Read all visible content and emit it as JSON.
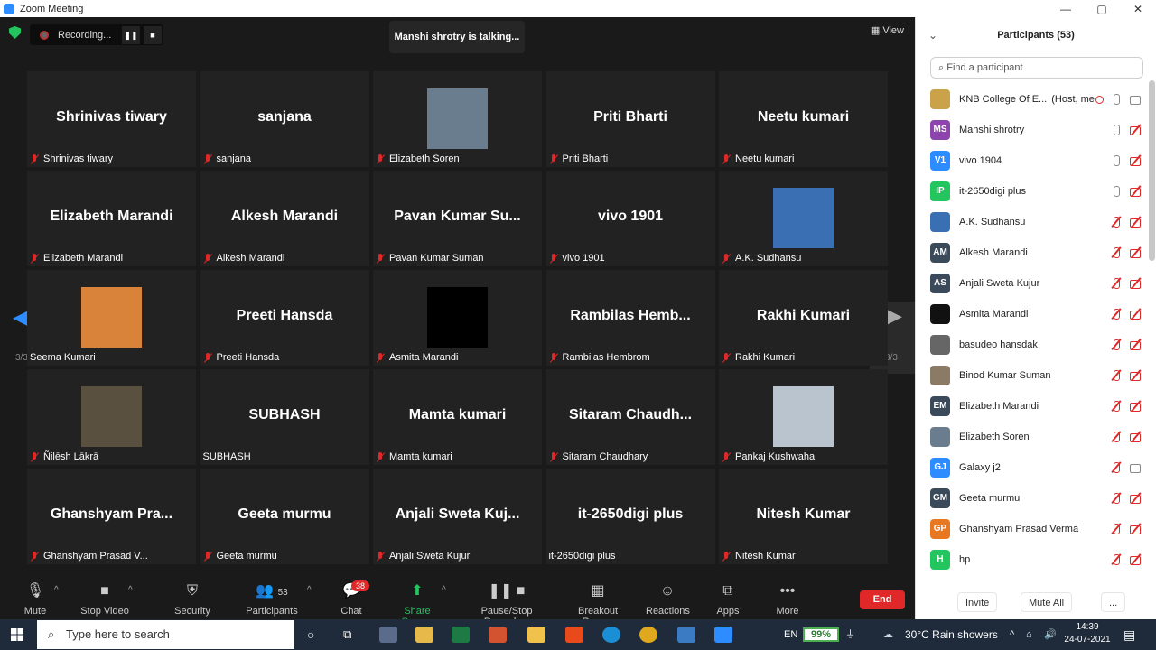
{
  "window": {
    "title": "Zoom Meeting",
    "controls": [
      "—",
      "▢",
      "✕"
    ]
  },
  "topbar": {
    "recording_label": "Recording...",
    "talking": "Manshi shrotry is talking...",
    "view_label": "View"
  },
  "pagination": {
    "left_page": "3/3",
    "right_page": "3/3"
  },
  "tiles": [
    {
      "big": "Shrinivas tiwary",
      "label": "Shrinivas tiwary",
      "muted": true,
      "photo": false
    },
    {
      "big": "sanjana",
      "label": "sanjana",
      "muted": true,
      "photo": false
    },
    {
      "big": "",
      "label": "Elizabeth Soren",
      "muted": true,
      "photo": true,
      "photo_color": "#6a7d8f"
    },
    {
      "big": "Priti Bharti",
      "label": "Priti Bharti",
      "muted": true,
      "photo": false
    },
    {
      "big": "Neetu kumari",
      "label": "Neetu kumari",
      "muted": true,
      "photo": false
    },
    {
      "big": "Elizabeth Marandi",
      "label": "Elizabeth Marandi",
      "muted": true,
      "photo": false
    },
    {
      "big": "Alkesh Marandi",
      "label": "Alkesh Marandi",
      "muted": true,
      "photo": false
    },
    {
      "big": "Pavan Kumar Su...",
      "label": "Pavan Kumar Suman",
      "muted": true,
      "photo": false
    },
    {
      "big": "vivo 1901",
      "label": "vivo 1901",
      "muted": true,
      "photo": false
    },
    {
      "big": "",
      "label": "A.K. Sudhansu",
      "muted": true,
      "photo": true,
      "photo_color": "#3a6fb3"
    },
    {
      "big": "",
      "label": "Seema Kumari",
      "muted": false,
      "photo": true,
      "photo_color": "#d8823a"
    },
    {
      "big": "Preeti Hansda",
      "label": "Preeti Hansda",
      "muted": true,
      "photo": false
    },
    {
      "big": "",
      "label": "Asmita Marandi",
      "muted": true,
      "photo": true,
      "photo_color": "#000000"
    },
    {
      "big": "Rambilas Hemb...",
      "label": "Rambilas Hembrom",
      "muted": true,
      "photo": false
    },
    {
      "big": "Rakhi Kumari",
      "label": "Rakhi Kumari",
      "muted": true,
      "photo": false
    },
    {
      "big": "",
      "label": "Ñilēsh Lākrā",
      "muted": true,
      "photo": true,
      "photo_color": "#5a5040"
    },
    {
      "big": "SUBHASH",
      "label": "SUBHASH",
      "muted": false,
      "photo": false
    },
    {
      "big": "Mamta kumari",
      "label": "Mamta kumari",
      "muted": true,
      "photo": false
    },
    {
      "big": "Sitaram Chaudh...",
      "label": "Sitaram Chaudhary",
      "muted": true,
      "photo": false
    },
    {
      "big": "",
      "label": "Pankaj Kushwaha",
      "muted": true,
      "photo": true,
      "photo_color": "#b9c4cf"
    },
    {
      "big": "Ghanshyam Pra...",
      "label": "Ghanshyam Prasad V...",
      "muted": true,
      "photo": false
    },
    {
      "big": "Geeta murmu",
      "label": "Geeta murmu",
      "muted": true,
      "photo": false
    },
    {
      "big": "Anjali Sweta Kuj...",
      "label": "Anjali Sweta Kujur",
      "muted": true,
      "photo": false
    },
    {
      "big": "it-2650digi plus",
      "label": "it-2650digi plus",
      "muted": false,
      "photo": false
    },
    {
      "big": "Nitesh Kumar",
      "label": "Nitesh Kumar",
      "muted": true,
      "photo": false
    }
  ],
  "toolbar": {
    "mute": "Mute",
    "stop_video": "Stop Video",
    "security": "Security",
    "participants": "Participants",
    "participants_count": "53",
    "chat": "Chat",
    "chat_badge": "38",
    "share_screen": "Share Screen",
    "pause_stop_recording": "Pause/Stop Recording",
    "breakout_rooms": "Breakout Rooms",
    "reactions": "Reactions",
    "apps": "Apps",
    "more": "More",
    "end": "End"
  },
  "panel": {
    "title": "Participants (53)",
    "search_placeholder": "Find a participant",
    "participants": [
      {
        "initials": "",
        "name": "KNB College Of E...",
        "host_tag": "(Host, me)",
        "color": "#c9a24a",
        "mic": "on",
        "video": "on",
        "recording": true
      },
      {
        "initials": "MS",
        "name": "Manshi shrotry",
        "color": "#8e44ad",
        "mic": "on",
        "video": "off"
      },
      {
        "initials": "V1",
        "name": "vivo 1904",
        "color": "#2d8cff",
        "mic": "on",
        "video": "off"
      },
      {
        "initials": "IP",
        "name": "it-2650digi plus",
        "color": "#23c55e",
        "mic": "on",
        "video": "off"
      },
      {
        "initials": "",
        "name": "A.K. Sudhansu",
        "color": "#3a6fb3",
        "mic": "off",
        "video": "off"
      },
      {
        "initials": "AM",
        "name": "Alkesh Marandi",
        "color": "#3b4a5a",
        "mic": "off",
        "video": "off"
      },
      {
        "initials": "AS",
        "name": "Anjali Sweta Kujur",
        "color": "#3b4a5a",
        "mic": "off",
        "video": "off"
      },
      {
        "initials": "",
        "name": "Asmita Marandi",
        "color": "#111111",
        "mic": "off",
        "video": "off"
      },
      {
        "initials": "",
        "name": "basudeo hansdak",
        "color": "#666666",
        "mic": "off",
        "video": "off"
      },
      {
        "initials": "",
        "name": "Binod Kumar Suman",
        "color": "#8a7a66",
        "mic": "off",
        "video": "off"
      },
      {
        "initials": "EM",
        "name": "Elizabeth Marandi",
        "color": "#3b4a5a",
        "mic": "off",
        "video": "off"
      },
      {
        "initials": "",
        "name": "Elizabeth Soren",
        "color": "#6a7d8f",
        "mic": "off",
        "video": "off"
      },
      {
        "initials": "GJ",
        "name": "Galaxy j2",
        "color": "#2d8cff",
        "mic": "off",
        "video": "on"
      },
      {
        "initials": "GM",
        "name": "Geeta murmu",
        "color": "#3b4a5a",
        "mic": "off",
        "video": "off"
      },
      {
        "initials": "GP",
        "name": "Ghanshyam Prasad Verma",
        "color": "#e87722",
        "mic": "off",
        "video": "off"
      },
      {
        "initials": "H",
        "name": "hp",
        "color": "#23c55e",
        "mic": "off",
        "video": "off"
      }
    ],
    "invite": "Invite",
    "mute_all": "Mute All",
    "more": "..."
  },
  "taskbar": {
    "search_placeholder": "Type here to search",
    "lang": "EN",
    "battery": "99%",
    "weather": "30°C  Rain showers",
    "time": "14:39",
    "date": "24-07-2021"
  }
}
